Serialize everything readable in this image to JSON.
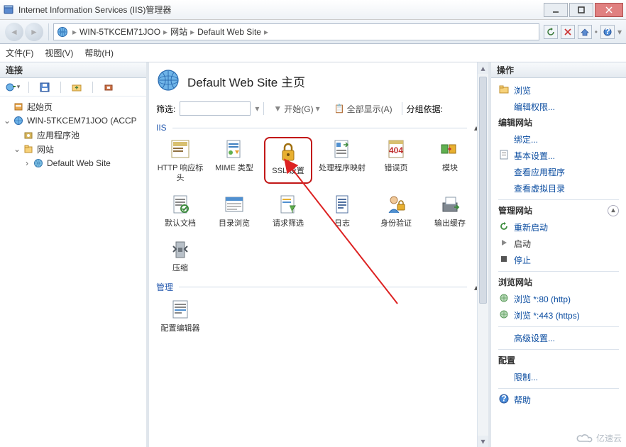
{
  "window": {
    "title": "Internet Information Services (IIS)管理器"
  },
  "breadcrumb": {
    "segments": [
      "WIN-5TKCEM71JOO",
      "网站",
      "Default Web Site"
    ]
  },
  "menus": {
    "file": "文件(F)",
    "view": "视图(V)",
    "help": "帮助(H)"
  },
  "left": {
    "header": "连接",
    "tree": {
      "start_page": "起始页",
      "server": "WIN-5TKCEM71JOO (ACCP",
      "app_pools": "应用程序池",
      "sites": "网站",
      "default_site": "Default Web Site"
    }
  },
  "center": {
    "heading": "Default Web Site 主页",
    "filter": {
      "label": "筛选:",
      "go": "开始(G)",
      "show_all": "全部显示(A)",
      "group_by": "分组依据:"
    },
    "group_iis": "IIS",
    "group_mgmt": "管理",
    "icons": {
      "http_headers": "HTTP 响应标头",
      "mime": "MIME 类型",
      "ssl": "SSL 设置",
      "handlers": "处理程序映射",
      "error_pages": "错误页",
      "modules": "模块",
      "default_doc": "默认文档",
      "dir_browse": "目录浏览",
      "request_filter": "请求筛选",
      "logging": "日志",
      "auth": "身份验证",
      "output_cache": "输出缓存",
      "compress": "压缩",
      "config_editor": "配置编辑器"
    }
  },
  "right": {
    "header": "操作",
    "explore": "浏览",
    "edit_perms": "编辑权限...",
    "edit_site_hdr": "编辑网站",
    "bindings": "绑定...",
    "basic_settings": "基本设置...",
    "view_apps": "查看应用程序",
    "view_vdirs": "查看虚拟目录",
    "manage_site_hdr": "管理网站",
    "restart": "重新启动",
    "start": "启动",
    "stop": "停止",
    "browse_site_hdr": "浏览网站",
    "browse80": "浏览 *:80 (http)",
    "browse443": "浏览 *:443 (https)",
    "adv_settings": "高级设置...",
    "configure_hdr": "配置",
    "limits": "限制...",
    "help": "帮助"
  },
  "watermark": "亿速云"
}
